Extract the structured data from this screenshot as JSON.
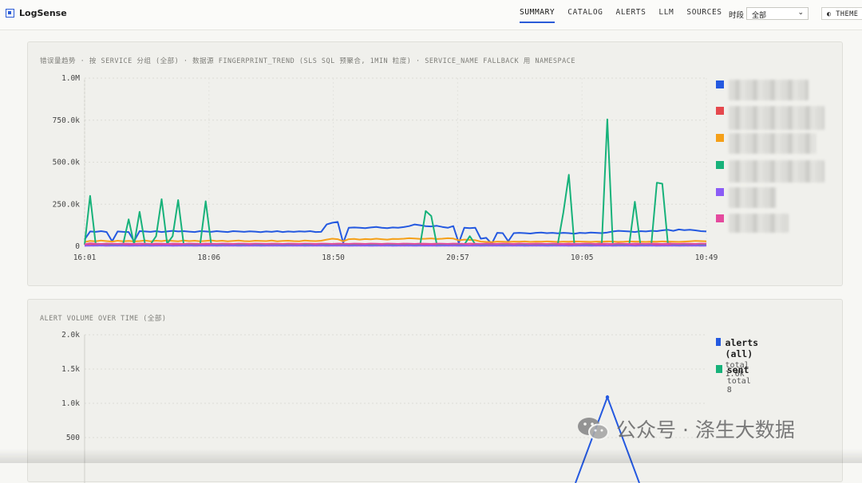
{
  "app": {
    "name": "LogSense"
  },
  "nav": {
    "items": [
      {
        "label": "SUMMARY",
        "active": true
      },
      {
        "label": "CATALOG"
      },
      {
        "label": "ALERTS"
      },
      {
        "label": "LLM"
      },
      {
        "label": "SOURCES"
      }
    ],
    "period_label": "时段",
    "period_value": "全部",
    "theme_label": "THEME"
  },
  "watermark": {
    "text": "公众号 · 涤生大数据"
  },
  "colors": {
    "blue": "#2459e0",
    "red": "#e5484d",
    "orange": "#f5a018",
    "green": "#17b27a",
    "purple": "#8b5cf6",
    "pink": "#e44a9e"
  },
  "chart_data": [
    {
      "type": "line",
      "title": "错误量趋势 · 按 SERVICE 分组 (全部) · 数据源 FINGERPRINT_TREND (SLS SQL 预聚合, 1MIN 粒度) · SERVICE_NAME FALLBACK 用 NAMESPACE",
      "ylim": [
        0,
        1000000
      ],
      "y_ticks": [
        "0",
        "250.0k",
        "500.0k",
        "750.0k",
        "1.0M"
      ],
      "x_ticks": [
        "16:01",
        "18:06",
        "18:50",
        "20:57",
        "10:05",
        "10:49"
      ],
      "legend_position": "right",
      "legend_labels_redacted": true,
      "series": [
        {
          "color": "#2459e0",
          "values": [
            40000,
            88000,
            86000,
            90000,
            85000,
            30000,
            88000,
            86000,
            85000,
            30000,
            90000,
            88000,
            86000,
            90000,
            85000,
            88000,
            92000,
            88000,
            90000,
            87000,
            85000,
            90000,
            88000,
            86000,
            90000,
            87000,
            85000,
            90000,
            88000,
            86000,
            89000,
            87000,
            84000,
            88000,
            86000,
            90000,
            85000,
            88000,
            86000,
            89000,
            87000,
            90000,
            85000,
            86000,
            130000,
            140000,
            145000,
            20000,
            110000,
            112000,
            110000,
            108000,
            112000,
            115000,
            110000,
            108000,
            112000,
            110000,
            114000,
            120000,
            130000,
            125000,
            120000,
            118000,
            122000,
            115000,
            110000,
            120000,
            20000,
            110000,
            108000,
            110000,
            45000,
            50000,
            15000,
            80000,
            78000,
            30000,
            78000,
            80000,
            78000,
            76000,
            80000,
            82000,
            78000,
            80000,
            77000,
            80000,
            78000,
            75000,
            80000,
            78000,
            82000,
            80000,
            78000,
            82000,
            88000,
            92000,
            90000,
            88000,
            85000,
            90000,
            88000,
            92000,
            90000,
            95000,
            98000,
            92000,
            100000,
            96000,
            98000,
            95000,
            90000,
            88000
          ]
        },
        {
          "color": "#e5484d",
          "values": [
            6000,
            8000,
            7000,
            9000,
            8000,
            6000,
            7000,
            9000,
            8000,
            7000,
            6000,
            8000,
            9000,
            7000,
            8000,
            6000,
            7000,
            9000,
            8000,
            7000,
            6000,
            8000,
            9000,
            7000,
            8000,
            6000,
            7000,
            9000,
            8000,
            7000,
            6000,
            8000,
            9000,
            7000,
            8000,
            6000,
            7000,
            9000,
            8000,
            7000,
            6000,
            8000,
            9000,
            7000,
            8000,
            6000,
            7000,
            9000,
            8000,
            7000,
            6000,
            8000,
            9000,
            7000,
            8000,
            6000,
            7000,
            9000,
            8000,
            7000,
            6000,
            8000,
            9000,
            7000,
            8000,
            6000,
            7000,
            9000,
            8000,
            7000,
            6000,
            8000,
            9000,
            7000,
            8000,
            6000,
            7000,
            9000,
            8000,
            7000,
            6000,
            8000,
            9000,
            7000,
            8000,
            6000,
            7000,
            9000,
            8000,
            7000,
            6000,
            8000,
            9000,
            7000,
            8000,
            6000,
            7000,
            9000,
            8000,
            7000,
            6000,
            8000,
            9000,
            7000,
            8000,
            6000,
            7000,
            9000,
            8000,
            7000,
            6000,
            8000,
            9000,
            7000
          ]
        },
        {
          "color": "#f5a018",
          "values": [
            25000,
            32000,
            30000,
            34000,
            31000,
            28000,
            33000,
            30000,
            32000,
            29000,
            31000,
            34000,
            30000,
            33000,
            31000,
            35000,
            32000,
            30000,
            34000,
            31000,
            33000,
            30000,
            32000,
            35000,
            31000,
            33000,
            30000,
            32000,
            34000,
            31000,
            30000,
            33000,
            32000,
            31000,
            34000,
            30000,
            32000,
            33000,
            31000,
            30000,
            34000,
            32000,
            31000,
            33000,
            40000,
            45000,
            42000,
            30000,
            42000,
            44000,
            40000,
            43000,
            41000,
            45000,
            42000,
            40000,
            44000,
            43000,
            45000,
            48000,
            46000,
            44000,
            45000,
            47000,
            43000,
            45000,
            48000,
            46000,
            35000,
            40000,
            38000,
            36000,
            28000,
            26000,
            25000,
            28000,
            27000,
            26000,
            28000,
            27000,
            29000,
            26000,
            28000,
            27000,
            29000,
            28000,
            26000,
            28000,
            27000,
            29000,
            28000,
            27000,
            26000,
            28000,
            27000,
            29000,
            28000,
            26000,
            27000,
            29000,
            28000,
            27000,
            26000,
            28000,
            27000,
            29000,
            28000,
            27000,
            26000,
            28000,
            30000,
            32000,
            31000,
            30000
          ]
        },
        {
          "color": "#17b27a",
          "values": [
            10000,
            300000,
            15000,
            12000,
            15000,
            10000,
            12000,
            14000,
            160000,
            12000,
            205000,
            10000,
            12000,
            60000,
            280000,
            15000,
            60000,
            275000,
            12000,
            10000,
            14000,
            12000,
            268000,
            12000,
            10000,
            12000,
            14000,
            12000,
            10000,
            12000,
            14000,
            12000,
            10000,
            12000,
            14000,
            12000,
            10000,
            12000,
            14000,
            12000,
            10000,
            12000,
            14000,
            12000,
            10000,
            12000,
            14000,
            12000,
            10000,
            12000,
            14000,
            12000,
            10000,
            12000,
            14000,
            12000,
            10000,
            12000,
            14000,
            12000,
            10000,
            12000,
            210000,
            180000,
            12000,
            10000,
            12000,
            14000,
            12000,
            10000,
            60000,
            12000,
            10000,
            12000,
            14000,
            12000,
            10000,
            12000,
            14000,
            12000,
            10000,
            12000,
            14000,
            12000,
            10000,
            12000,
            14000,
            200000,
            425000,
            15000,
            12000,
            10000,
            12000,
            14000,
            18000,
            755000,
            12000,
            10000,
            12000,
            14000,
            265000,
            12000,
            10000,
            12000,
            378000,
            372000,
            20000,
            12000,
            10000,
            12000,
            14000,
            12000,
            10000,
            12000
          ]
        },
        {
          "color": "#8b5cf6",
          "values": [
            3000,
            4000,
            3500,
            4500,
            3000,
            4000,
            3500,
            4500,
            3000,
            4000,
            3500,
            4500,
            3000,
            4000,
            3500,
            4500,
            3000,
            4000,
            3500,
            4500,
            3000,
            4000,
            3500,
            4500,
            3000,
            4000,
            3500,
            4500,
            3000,
            4000,
            3500,
            4500,
            3000,
            4000,
            3500,
            4500,
            3000,
            4000,
            3500,
            4500,
            3000,
            4000,
            3500,
            4500,
            3000,
            4000,
            3500,
            4500,
            3000,
            4000,
            3500,
            4500,
            3000,
            4000,
            3500,
            4500,
            3000,
            4000,
            3500,
            4500,
            3000,
            4000,
            3500,
            4500,
            3000,
            4000,
            3500,
            4500,
            3000,
            4000,
            3500,
            4500,
            3000,
            4000,
            3500,
            4500,
            3000,
            4000,
            3500,
            4500,
            3000,
            4000,
            3500,
            4500,
            3000,
            4000,
            3500,
            4500,
            3000,
            4000,
            3500,
            4500,
            3000,
            4000,
            3500,
            4500,
            3000,
            4000,
            3500,
            4500,
            3000,
            4000,
            3500,
            4500,
            3000,
            4000,
            3500,
            4500,
            3000,
            4000,
            3500,
            4500,
            3000,
            4000
          ]
        },
        {
          "color": "#e44a9e",
          "values": [
            12000,
            18000,
            15000,
            14000,
            16000,
            15000,
            14000,
            16000,
            15000,
            14000,
            16000,
            15000,
            14000,
            16000,
            15000,
            14000,
            16000,
            15000,
            14000,
            16000,
            15000,
            14000,
            16000,
            15000,
            14000,
            16000,
            15000,
            14000,
            16000,
            15000,
            14000,
            16000,
            15000,
            14000,
            16000,
            15000,
            14000,
            16000,
            15000,
            14000,
            16000,
            15000,
            14000,
            16000,
            15000,
            14000,
            16000,
            15000,
            14000,
            16000,
            15000,
            14000,
            16000,
            15000,
            14000,
            16000,
            15000,
            14000,
            16000,
            15000,
            14000,
            16000,
            15000,
            14000,
            16000,
            15000,
            14000,
            16000,
            15000,
            14000,
            16000,
            15000,
            14000,
            16000,
            15000,
            14000,
            16000,
            15000,
            14000,
            16000,
            15000,
            14000,
            16000,
            15000,
            14000,
            16000,
            15000,
            14000,
            16000,
            15000,
            14000,
            16000,
            15000,
            14000,
            16000,
            15000,
            14000,
            16000,
            15000,
            14000,
            16000,
            15000,
            14000,
            16000,
            15000,
            14000,
            16000,
            15000,
            14000,
            16000,
            15000,
            14000,
            16000,
            15000
          ]
        }
      ]
    },
    {
      "type": "line",
      "title": "ALERT VOLUME OVER TIME (全部)",
      "ylim": [
        0,
        2000
      ],
      "y_ticks": [
        "500",
        "1.0k",
        "1.5k",
        "2.0k"
      ],
      "legend_position": "right",
      "series": [
        {
          "name": "alerts (all)",
          "color": "#2459e0",
          "subtitle": "total 1.6k",
          "peak_value": 1090
        },
        {
          "name": "sent",
          "color": "#17b27a",
          "subtitle": "total 8"
        }
      ]
    }
  ]
}
